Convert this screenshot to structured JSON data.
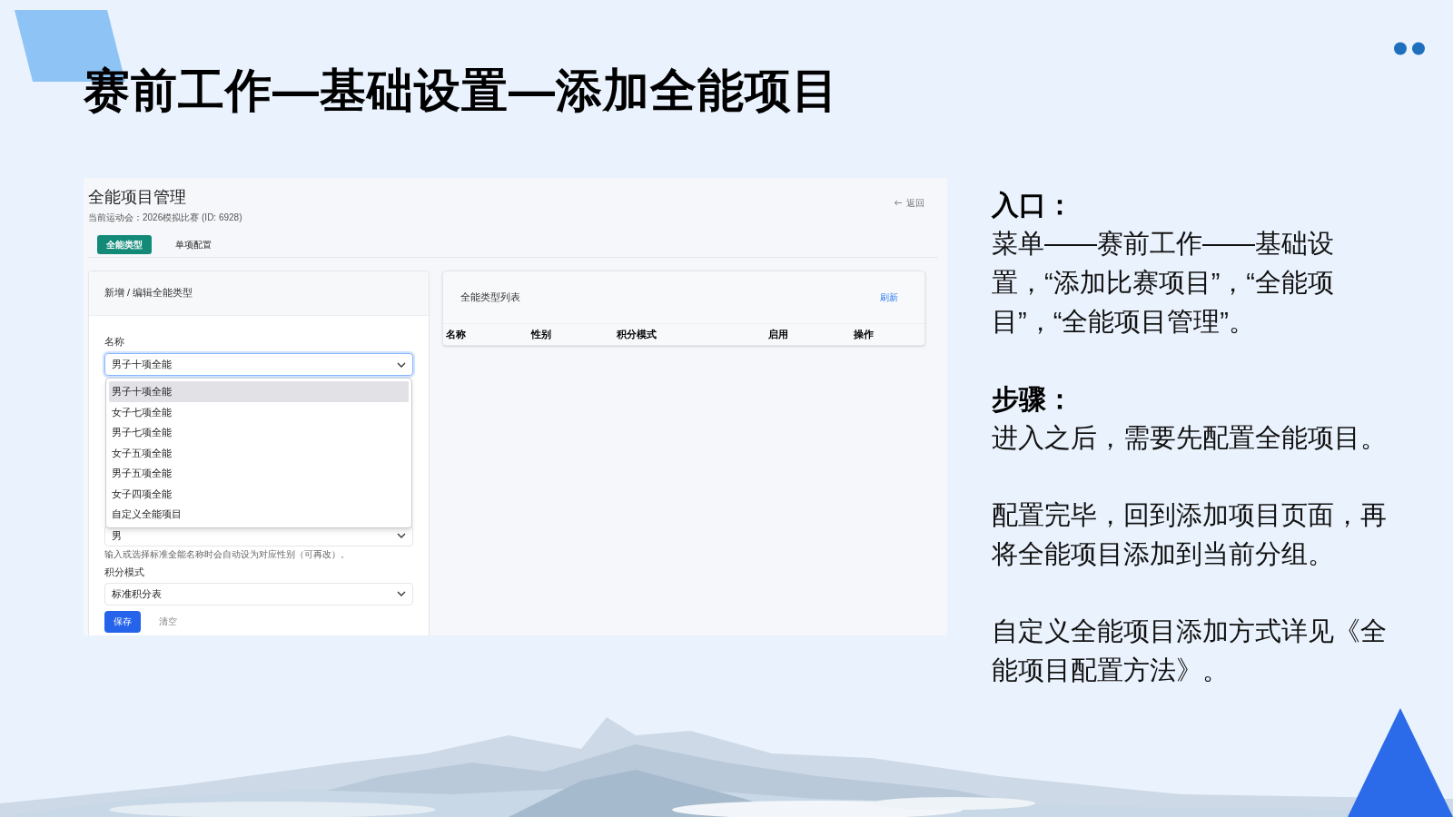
{
  "slide": {
    "title": "赛前工作—基础设置—添加全能项目"
  },
  "screenshot": {
    "page_title": "全能项目管理",
    "meeting": "当前运动会：2026模拟比赛 (ID: 6928)",
    "back_link": "返回",
    "tabs": [
      {
        "label": "全能类型",
        "selected": true
      },
      {
        "label": "单项配置",
        "selected": false
      }
    ],
    "form": {
      "header": "新增 / 编辑全能类型",
      "name_label": "名称",
      "name_value": "男子十项全能",
      "name_options": [
        {
          "label": "男子十项全能",
          "selected": true
        },
        {
          "label": "女子七项全能",
          "selected": false
        },
        {
          "label": "男子七项全能",
          "selected": false
        },
        {
          "label": "女子五项全能",
          "selected": false
        },
        {
          "label": "男子五项全能",
          "selected": false
        },
        {
          "label": "女子四项全能",
          "selected": false
        },
        {
          "label": "自定义全能项目",
          "selected": false
        }
      ],
      "gender_value": "男",
      "hint": "输入或选择标准全能名称时会自动设为对应性别（可再改）。",
      "scoring_label": "积分模式",
      "scoring_value": "标准积分表",
      "buttons": [
        {
          "label": "保存",
          "kind": "primary"
        },
        {
          "label": "清空",
          "kind": "plain"
        }
      ]
    },
    "list": {
      "header": "全能类型列表",
      "refresh": "刷新",
      "columns": [
        "名称",
        "性别",
        "积分模式",
        "启用",
        "操作"
      ]
    }
  },
  "notes": [
    {
      "kind": "heading",
      "text": "入口："
    },
    {
      "kind": "paragraph",
      "text": "菜单——赛前工作——基础设置，“添加比赛项目”，“全能项目”，“全能项目管理”。"
    },
    {
      "kind": "heading",
      "text": "步骤："
    },
    {
      "kind": "paragraph",
      "text": "进入之后，需要先配置全能项目。"
    },
    {
      "kind": "paragraph",
      "text": "配置完毕，回到添加项目页面，再将全能项目添加到当前分组。"
    },
    {
      "kind": "paragraph",
      "text": "自定义全能项目添加方式详见《全能项目配置方法》。"
    }
  ]
}
